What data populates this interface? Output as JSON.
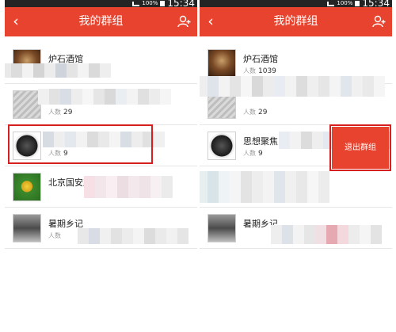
{
  "status_bar": {
    "battery_percent": "100%",
    "time": "15:34"
  },
  "title_bar": {
    "title": "我的群组",
    "back_icon": "chevron-left-icon",
    "action_icon": "add-member-icon"
  },
  "left_list": {
    "rows": [
      {
        "name": "炉石酒馆",
        "members_label": "人数",
        "count": ""
      },
      {
        "name": "",
        "members_label": "人数",
        "count": "29"
      },
      {
        "name": "",
        "members_label": "人数",
        "count": "9"
      },
      {
        "name": "北京国安跑团",
        "members_label": "",
        "count": ""
      },
      {
        "name": "暑期乡记",
        "members_label": "人数",
        "count": ""
      }
    ]
  },
  "right_list": {
    "rows": [
      {
        "name": "炉石酒馆",
        "members_label": "人数",
        "count": "1039"
      },
      {
        "name": "",
        "members_label": "人数",
        "count": "29"
      },
      {
        "name": "思想聚焦",
        "members_label": "人数",
        "count": "9"
      },
      {
        "name": "",
        "members_label": "",
        "count": ""
      },
      {
        "name": "暑期乡记",
        "members_label": "",
        "count": ""
      }
    ],
    "quit_button_label": "退出群组"
  },
  "colors": {
    "title_bar": "#e8432e",
    "highlight_border": "#d61f1f"
  }
}
